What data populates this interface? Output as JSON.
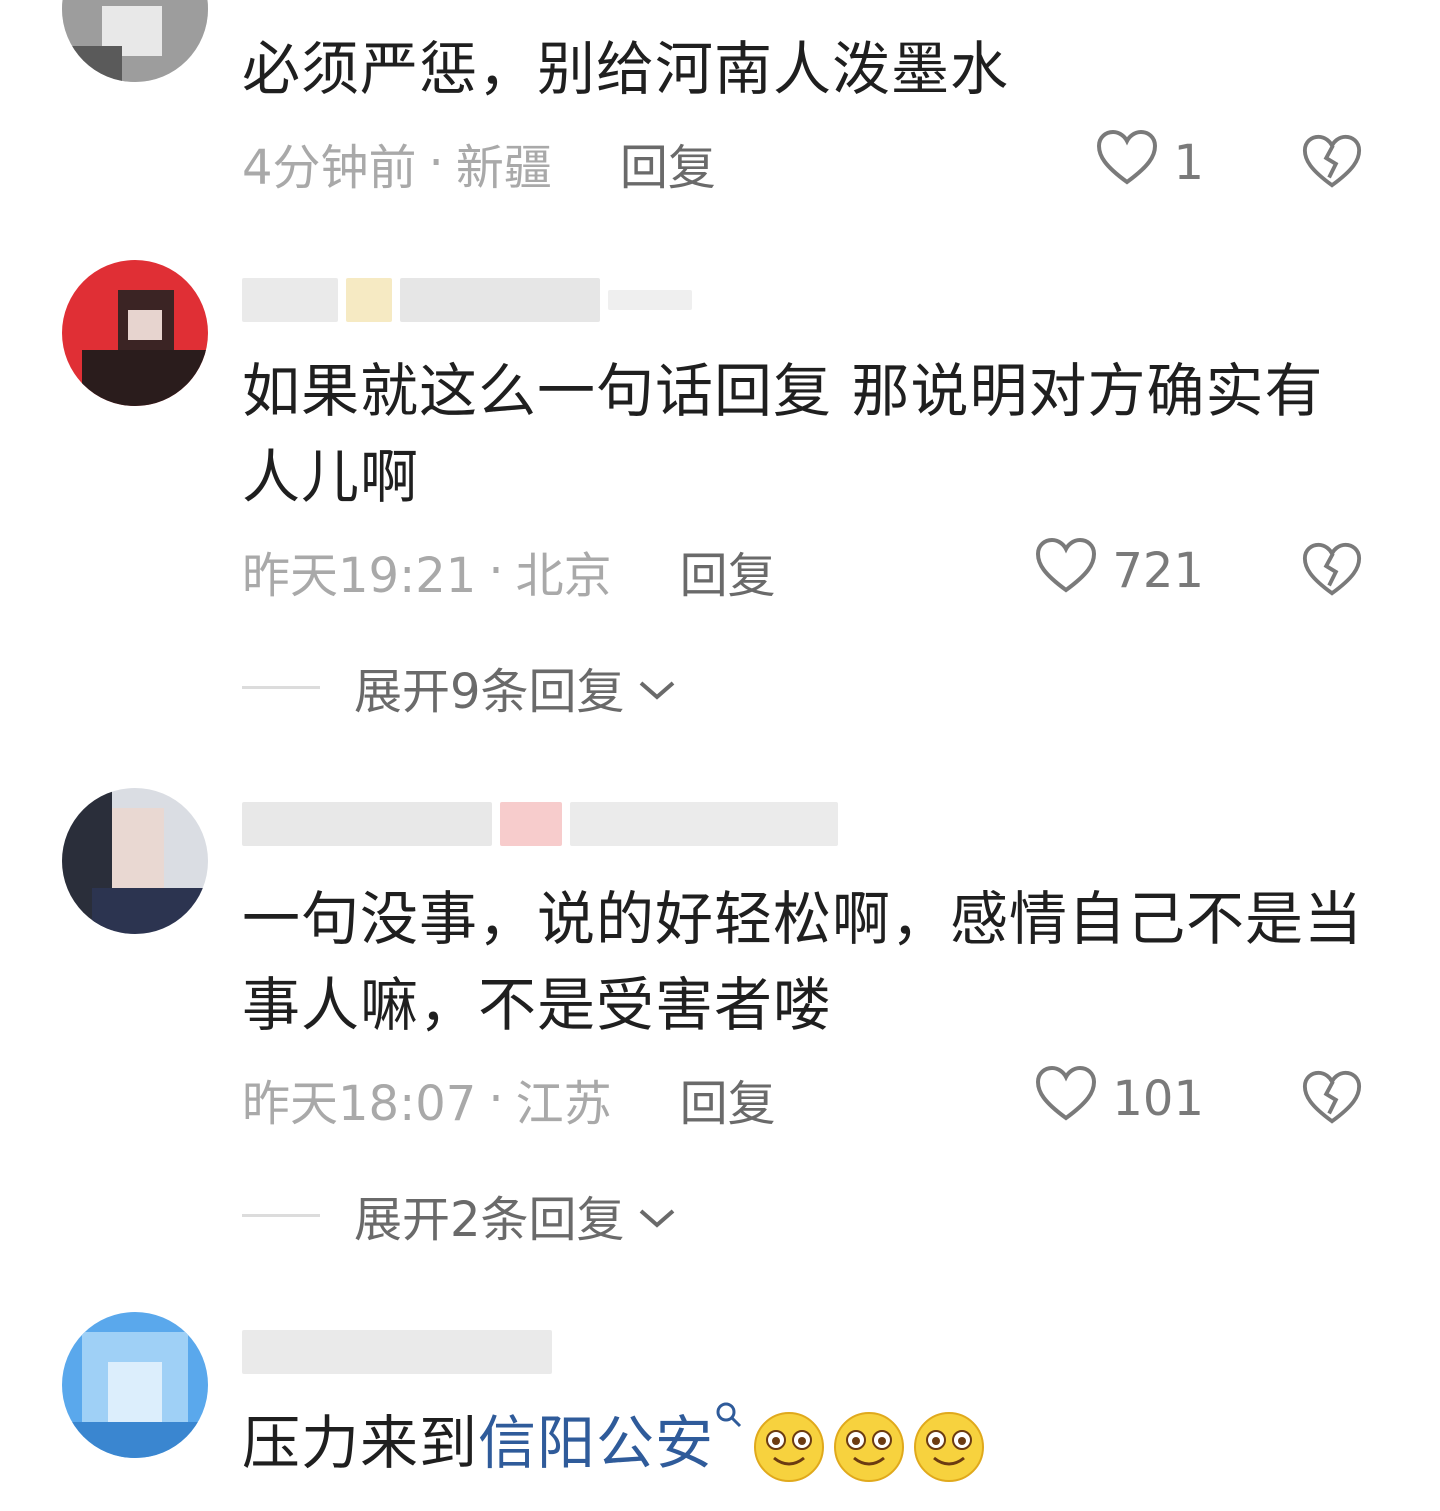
{
  "comments": [
    {
      "text": "必须严惩，别给河南人泼墨水",
      "time": "4分钟前",
      "location": "新疆",
      "reply_label": "回复",
      "likes": "1"
    },
    {
      "text": "如果就这么一句话回复  那说明对方确实有人儿啊",
      "time": "昨天19:21",
      "location": "北京",
      "reply_label": "回复",
      "likes": "721",
      "expand_label": "展开9条回复"
    },
    {
      "text": "一句没事，说的好轻松啊，感情自己不是当事人嘛，不是受害者喽",
      "time": "昨天18:07",
      "location": "江苏",
      "reply_label": "回复",
      "likes": "101",
      "expand_label": "展开2条回复"
    },
    {
      "text_prefix": "压力来到",
      "topic_link": "信阳公安"
    }
  ],
  "separator": "·",
  "icons": {
    "like": "heart-outline-icon",
    "dislike": "broken-heart-icon",
    "expand": "chevron-down-icon",
    "topic": "search-icon",
    "emoji": "smiley-emoji-icon"
  },
  "colors": {
    "text": "#1f1f1f",
    "meta": "#a9a9a9",
    "link": "#2f5b9a"
  }
}
